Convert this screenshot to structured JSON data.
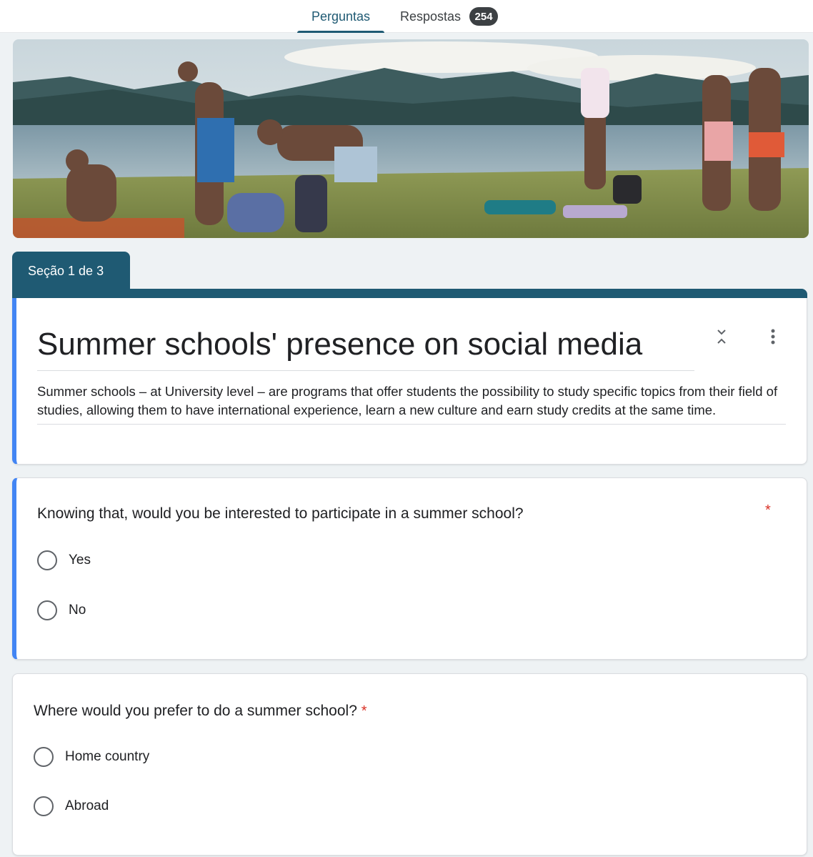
{
  "tabs": {
    "questions": "Perguntas",
    "responses": "Respostas",
    "responses_count": "254"
  },
  "colors": {
    "theme": "#1f5a73",
    "active_accent": "#4285f4",
    "required": "#d93025"
  },
  "section": {
    "label": "Seção 1 de 3"
  },
  "form": {
    "title": "Summer schools' presence on social media",
    "description": "Summer schools – at University level – are programs that offer students the possibility to study specific topics from their field of studies, allowing them to have international experience, learn a new culture and earn study credits at the same time."
  },
  "icons": {
    "collapse": "collapse-icon",
    "more": "more-vert-icon",
    "radio": "radio-unchecked-icon"
  },
  "questions": [
    {
      "text": "Knowing that, would you be interested to participate in a summer school?",
      "required_mark": "*",
      "options": [
        "Yes",
        "No"
      ]
    },
    {
      "text": "Where would you prefer to do a summer school?",
      "required_mark": "*",
      "options": [
        "Home country",
        "Abroad"
      ]
    }
  ]
}
